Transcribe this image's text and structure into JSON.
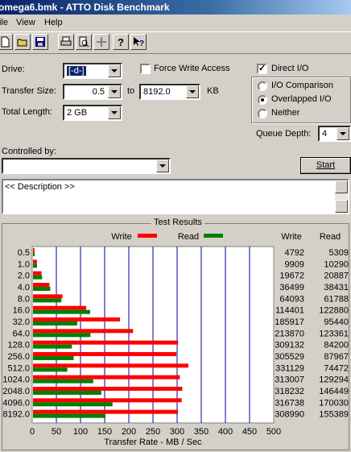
{
  "window": {
    "title": "omega6.bmk - ATTO Disk Benchmark"
  },
  "menu": {
    "items": [
      "ile",
      "View",
      "Help"
    ]
  },
  "toolbar": {
    "icons": [
      "new-icon",
      "open-icon",
      "save-icon",
      "print-icon",
      "print-preview-icon",
      "move-icon",
      "help-icon",
      "context-help-icon"
    ]
  },
  "settings": {
    "drive_label": "Drive:",
    "drive_value": "[-d-]",
    "force_write_label": "Force Write Access",
    "force_write_checked": false,
    "direct_io_label": "Direct I/O",
    "direct_io_checked": true,
    "transfer_size_label": "Transfer Size:",
    "transfer_from": "0.5",
    "to_label": "to",
    "transfer_to": "8192.0",
    "kb_label": "KB",
    "total_length_label": "Total Length:",
    "total_length_value": "2 GB",
    "io_modes": [
      {
        "label": "I/O Comparison",
        "selected": false
      },
      {
        "label": "Overlapped I/O",
        "selected": true
      },
      {
        "label": "Neither",
        "selected": false
      }
    ],
    "queue_depth_label": "Queue Depth:",
    "queue_depth_value": "4",
    "controlled_by_label": "Controlled by:",
    "controlled_by_value": "",
    "start_label": "Start",
    "description": "<< Description >>"
  },
  "results": {
    "title": "Test Results",
    "write_col": "Write",
    "read_col": "Read"
  },
  "chart_data": {
    "type": "bar",
    "orientation": "horizontal",
    "title": "Test Results",
    "xlabel": "Transfer Rate - MB / Sec",
    "ylabel": "",
    "xlim": [
      0,
      500
    ],
    "xticks": [
      0,
      50,
      100,
      150,
      200,
      250,
      300,
      350,
      400,
      450,
      500
    ],
    "grid": true,
    "legend": "top",
    "colors": {
      "write": "#ff0000",
      "read": "#008000",
      "grid": "#0000a0",
      "background": "#ffffff"
    },
    "categories": [
      "0.5",
      "1.0",
      "2.0",
      "4.0",
      "8.0",
      "16.0",
      "32.0",
      "64.0",
      "128.0",
      "256.0",
      "512.0",
      "1024.0",
      "2048.0",
      "4096.0",
      "8192.0"
    ],
    "series": [
      {
        "name": "Write",
        "values_mb": [
          4.7,
          9.7,
          19.2,
          35.6,
          62.6,
          111.7,
          181.6,
          208.8,
          301.9,
          298.4,
          323.4,
          305.7,
          310.8,
          309.3,
          301.7
        ],
        "labels": [
          "4792",
          "9909",
          "19672",
          "36499",
          "64093",
          "114401",
          "185917",
          "213870",
          "309132",
          "305529",
          "331129",
          "313007",
          "318232",
          "316738",
          "308990"
        ]
      },
      {
        "name": "Read",
        "values_mb": [
          5.2,
          10.0,
          20.4,
          37.5,
          60.3,
          120.0,
          93.2,
          120.5,
          82.2,
          85.9,
          72.7,
          126.3,
          143.0,
          166.2,
          151.7
        ],
        "labels": [
          "5309",
          "10290",
          "20887",
          "38431",
          "61788",
          "122880",
          "95440",
          "123361",
          "84200",
          "87967",
          "74472",
          "129294",
          "146449",
          "170030",
          "155389"
        ]
      }
    ]
  }
}
